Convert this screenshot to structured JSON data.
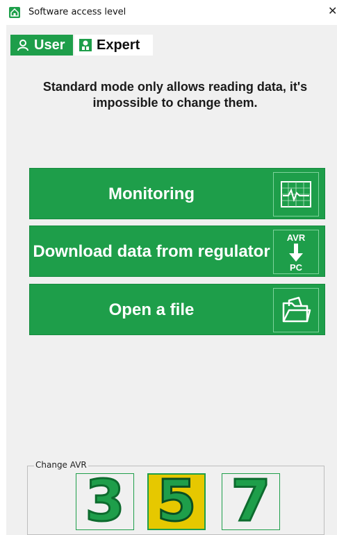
{
  "window": {
    "title": "Software access level",
    "close_glyph": "✕"
  },
  "tabs": [
    {
      "label": "User",
      "icon": "user-icon",
      "active": true
    },
    {
      "label": "Expert",
      "icon": "expert-icon",
      "active": false
    }
  ],
  "message": "Standard mode only allows reading data, it's impossible to change them.",
  "actions": [
    {
      "label": "Monitoring",
      "icon": "monitor-chart-icon"
    },
    {
      "label": "Download data from regulator",
      "icon": "avr-to-pc-icon",
      "icon_top": "AVR",
      "icon_bottom": "PC"
    },
    {
      "label": "Open a file",
      "icon": "open-folder-icon"
    }
  ],
  "avr": {
    "legend": "Change AVR",
    "options": [
      {
        "value": "3",
        "selected": false
      },
      {
        "value": "5",
        "selected": true
      },
      {
        "value": "7",
        "selected": false
      }
    ]
  },
  "colors": {
    "accent": "#1e9e4a",
    "selected_bg": "#e6c800"
  }
}
